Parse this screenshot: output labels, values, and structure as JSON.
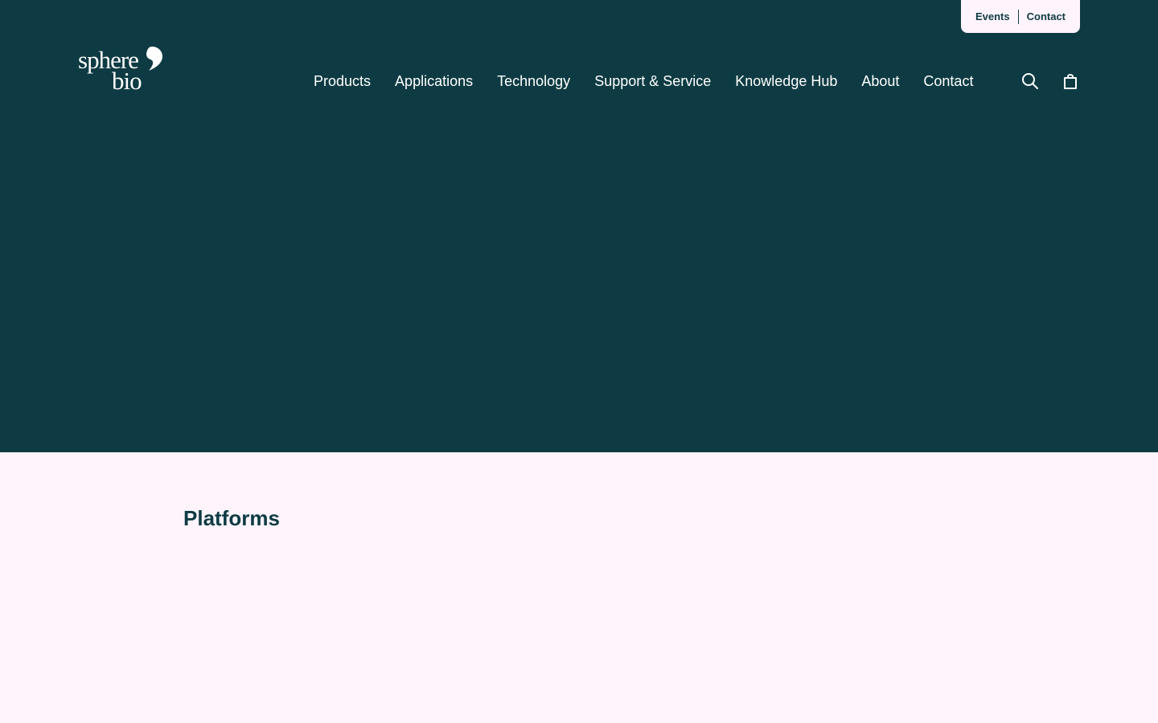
{
  "colors": {
    "primary_dark": "#0e3b43",
    "light_background": "#fff4fc",
    "white": "#ffffff"
  },
  "utility_nav": {
    "events_label": "Events",
    "contact_label": "Contact"
  },
  "logo": {
    "line1": "sphere",
    "line2": "bio"
  },
  "main_nav": {
    "items": [
      {
        "label": "Products"
      },
      {
        "label": "Applications"
      },
      {
        "label": "Technology"
      },
      {
        "label": "Support & Service"
      },
      {
        "label": "Knowledge Hub"
      },
      {
        "label": "About"
      },
      {
        "label": "Contact"
      }
    ]
  },
  "icons": {
    "search": "search-icon",
    "cart": "shopping-bag-icon"
  },
  "content": {
    "section_title": "Platforms"
  }
}
